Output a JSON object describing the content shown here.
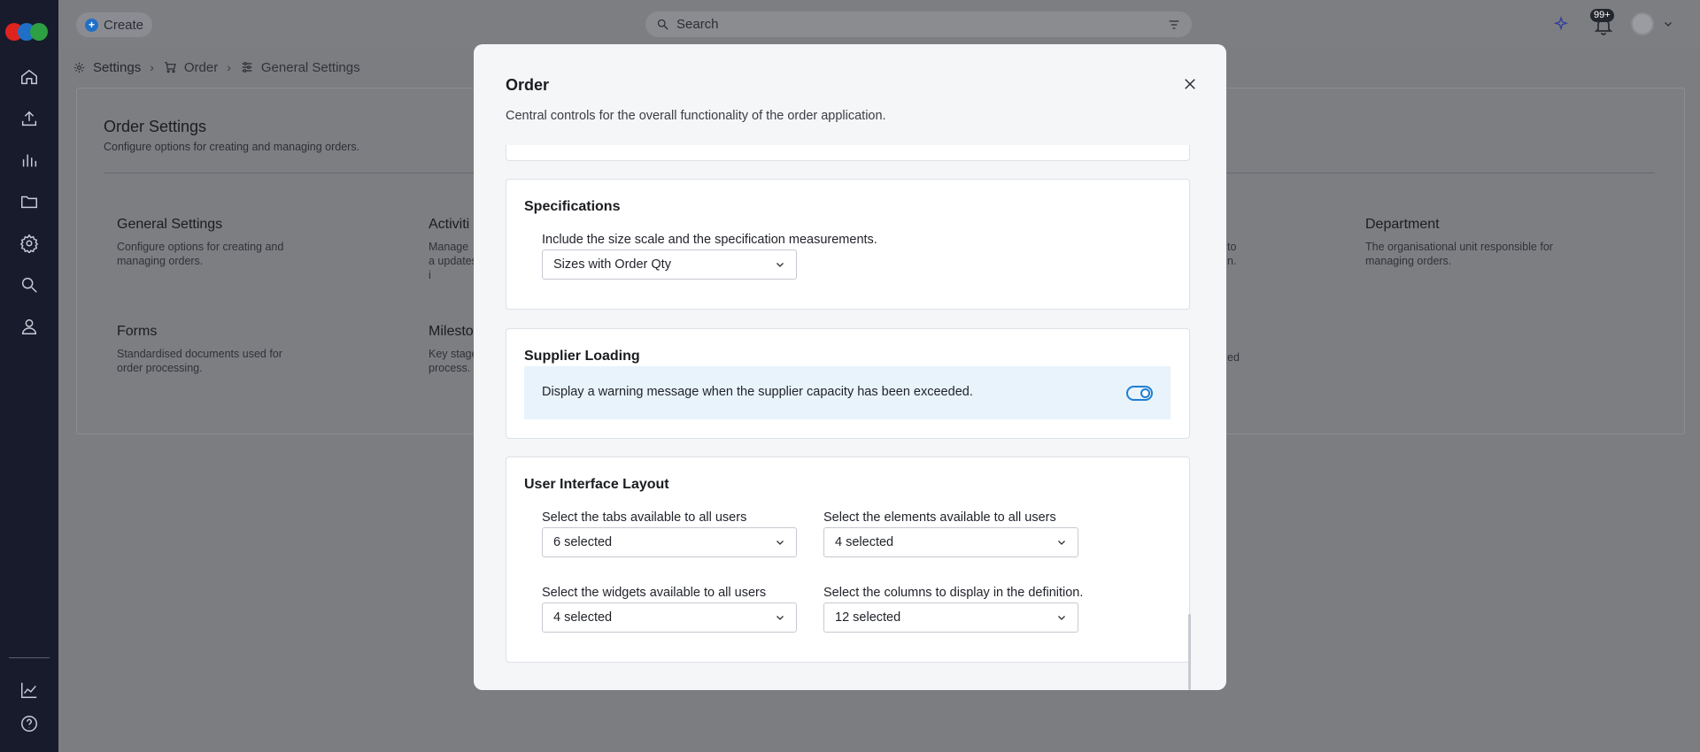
{
  "colors": {
    "sidebar_bg": "#171b2c",
    "accent": "#1f7fd1",
    "logo_colors": [
      "#e0231e",
      "#1f6fc7",
      "#2ea043"
    ]
  },
  "sidebar": {
    "icons": [
      "home-icon",
      "upload-icon",
      "chart-icon",
      "folder-icon",
      "gear-icon",
      "search-icon",
      "user-icon",
      "analytics-icon",
      "help-icon"
    ]
  },
  "topbar": {
    "create_label": "Create",
    "search_placeholder": "Search",
    "notification_badge": "99+"
  },
  "breadcrumb": {
    "items": [
      {
        "label": "Settings",
        "icon": "gear-icon"
      },
      {
        "label": "Order",
        "icon": "cart-icon"
      },
      {
        "label": "General Settings",
        "icon": "sliders-icon"
      }
    ]
  },
  "page": {
    "title": "Order Settings",
    "subtitle": "Configure options for creating and managing orders.",
    "tiles": [
      {
        "title": "General Settings",
        "desc": "Configure options for creating and managing orders."
      },
      {
        "title": "Activiti",
        "desc": "Manage a updates i"
      },
      {
        "title": "",
        "desc": "to n."
      },
      {
        "title": "Department",
        "desc": "The organisational unit responsible for managing orders."
      },
      {
        "title": "Forms",
        "desc": "Standardised documents used for order processing."
      },
      {
        "title": "Milesto",
        "desc": "Key stage process."
      },
      {
        "title": "",
        "desc": "ed"
      }
    ]
  },
  "modal": {
    "title": "Order",
    "description": "Central controls for the overall functionality of the order application.",
    "specifications": {
      "title": "Specifications",
      "label": "Include the size scale and the specification measurements.",
      "value": "Sizes with Order Qty"
    },
    "supplier_loading": {
      "title": "Supplier Loading",
      "label": "Display a warning message when the supplier capacity has been exceeded.",
      "enabled": true
    },
    "ui_layout": {
      "title": "User Interface Layout",
      "tabs_label": "Select the tabs available to all users",
      "tabs_value": "6 selected",
      "elements_label": "Select the elements available to all users",
      "elements_value": "4 selected",
      "widgets_label": "Select the widgets available to all users",
      "widgets_value": "4 selected",
      "columns_label": "Select the columns to display in the definition.",
      "columns_value": "12 selected"
    }
  }
}
